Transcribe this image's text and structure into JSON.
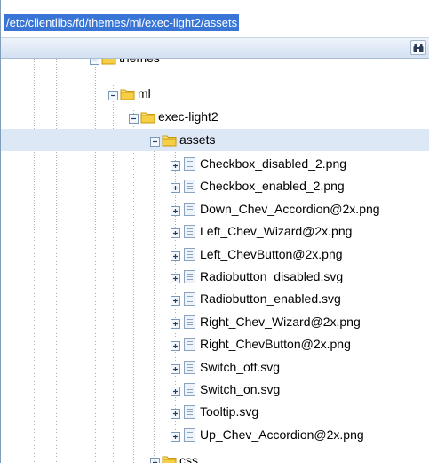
{
  "path_bar": {
    "value": "/etc/clientlibs/fd/themes/ml/exec-light2/assets"
  },
  "toolbar": {
    "icon": "binoculars-icon"
  },
  "tree": {
    "partial_label": "themes",
    "ml": "ml",
    "exec_light2": "exec-light2",
    "assets": "assets",
    "files": [
      "Checkbox_disabled_2.png",
      "Checkbox_enabled_2.png",
      "Down_Chev_Accordion@2x.png",
      "Left_Chev_Wizard@2x.png",
      "Left_ChevButton@2x.png",
      "Radiobutton_disabled.svg",
      "Radiobutton_enabled.svg",
      "Right_Chev_Wizard@2x.png",
      "Right_ChevButton@2x.png",
      "Switch_off.svg",
      "Switch_on.svg",
      "Tooltip.svg",
      "Up_Chev_Accordion@2x.png"
    ],
    "css": "css"
  },
  "colors": {
    "selection": "#3875d7",
    "selected_row": "#dde8f6",
    "folder": "#f2c22e"
  }
}
